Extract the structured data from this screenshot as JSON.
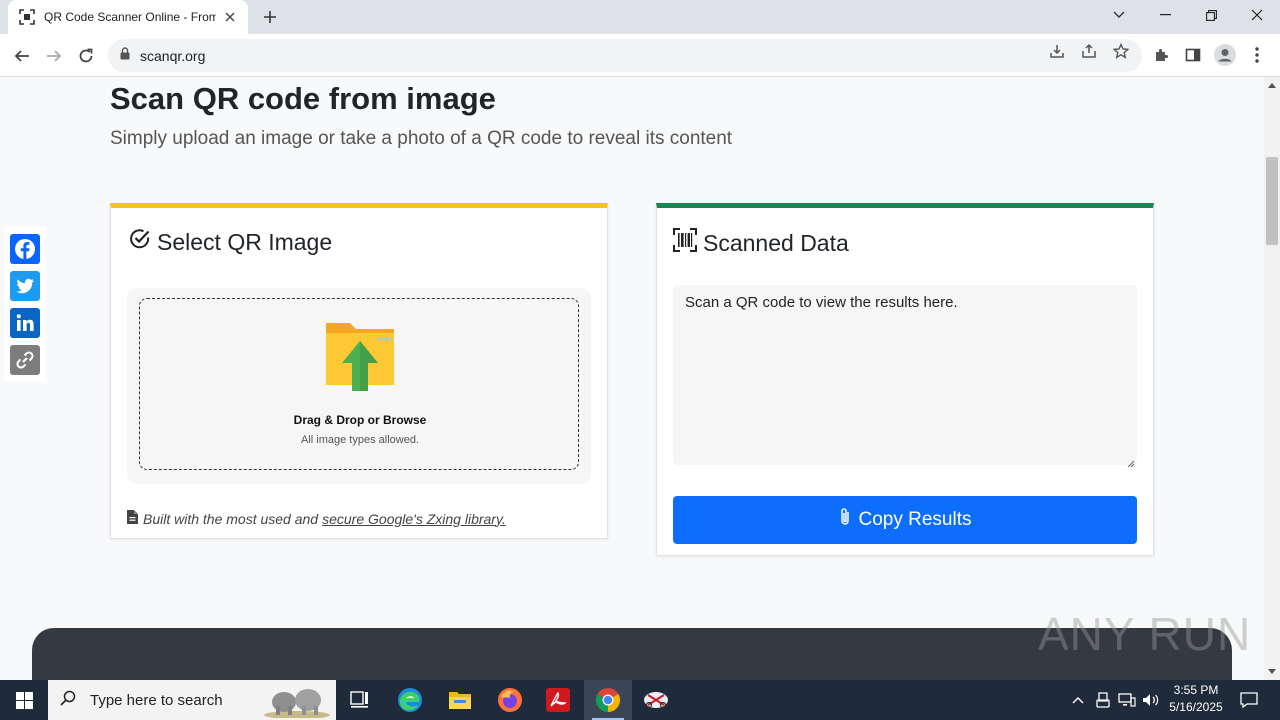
{
  "browser": {
    "tab_title": "QR Code Scanner Online - From",
    "url": "scanqr.org"
  },
  "page": {
    "heading": "Scan QR code from image",
    "lead": "Simply upload an image or take a photo of a QR code to reveal its content",
    "select_card": {
      "title": "Select QR Image",
      "accent": "#f5c518",
      "dropzone_title": "Drag & Drop or Browse",
      "dropzone_sub": "All image types allowed.",
      "built_prefix": "Built with the most used and",
      "built_link": "secure Google's Zxing library."
    },
    "scanned_card": {
      "title": "Scanned Data",
      "accent": "#198754",
      "result_placeholder": "Scan a QR code to view the results here.",
      "copy_label": "Copy Results",
      "button_color": "#0d6efd"
    },
    "share": [
      "facebook-icon",
      "twitter-icon",
      "linkedin-icon",
      "copy-link-icon"
    ],
    "watermark": "ANY RUN"
  },
  "taskbar": {
    "search_placeholder": "Type here to search",
    "time": "3:55 PM",
    "date": "5/16/2025"
  }
}
